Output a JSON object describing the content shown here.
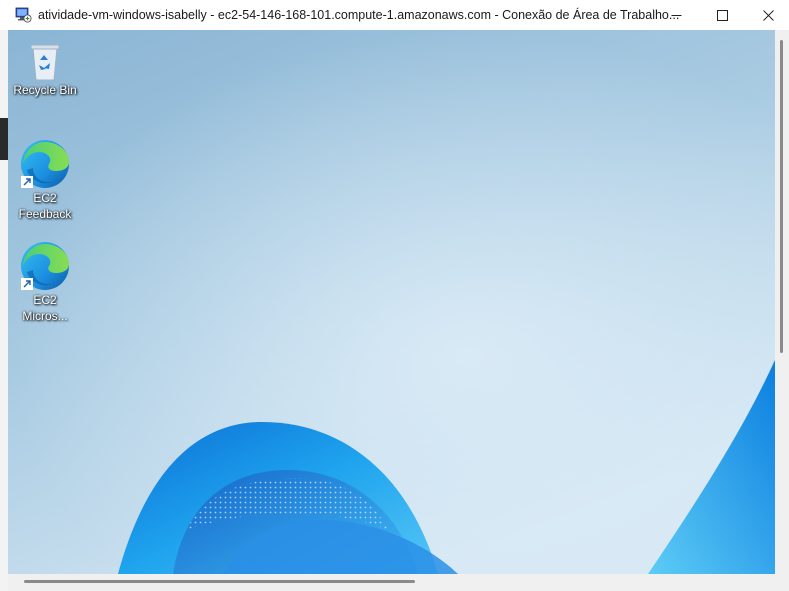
{
  "window": {
    "title": "atividade-vm-windows-isabelly - ec2-54-146-168-101.compute-1.amazonaws.com - Conexão de Área de Trabalho...",
    "app_icon": "remote-desktop-icon",
    "controls": [
      "minimize-icon",
      "maximize-icon",
      "close-icon"
    ]
  },
  "desktop": {
    "icons": [
      {
        "label": "Recycle Bin",
        "icon": "recycle-bin-icon"
      },
      {
        "label_line1": "EC2",
        "label_line2": "Feedback",
        "icon": "edge-icon"
      },
      {
        "label_line1": "EC2",
        "label_line2": "Micros...",
        "icon": "edge-icon"
      }
    ]
  },
  "colors": {
    "wallpaper_top": "#8fb8d6",
    "wallpaper_bottom": "#cfe3f0",
    "bloom_accent": "#1b9ce5"
  }
}
